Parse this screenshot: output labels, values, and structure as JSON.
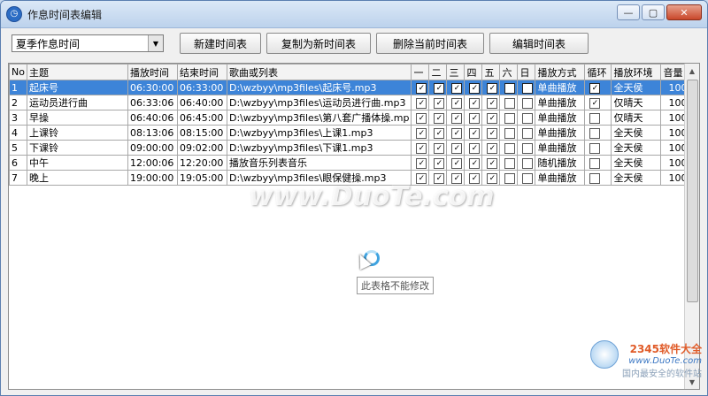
{
  "window": {
    "title": "作息时间表编辑",
    "app_icon": "clock-icon",
    "controls": {
      "minimize": "—",
      "maximize": "▢",
      "close": "✕"
    }
  },
  "toolbar": {
    "schedule_select": {
      "value": "夏季作息时间"
    },
    "buttons": {
      "new": "新建时间表",
      "copy": "复制为新时间表",
      "delete": "删除当前时间表",
      "edit": "编辑时间表"
    }
  },
  "table": {
    "headers": [
      "No",
      "主题",
      "播放时间",
      "结束时间",
      "歌曲或列表",
      "一",
      "二",
      "三",
      "四",
      "五",
      "六",
      "日",
      "播放方式",
      "循环",
      "播放环境",
      "音量"
    ],
    "selected_row": 0,
    "rows": [
      {
        "no": "1",
        "topic": "起床号",
        "start": "06:30:00",
        "end": "06:33:00",
        "song": "D:\\wzbyy\\mp3files\\起床号.mp3",
        "days": [
          true,
          true,
          true,
          true,
          true,
          false,
          false
        ],
        "mode": "单曲播放",
        "loop": true,
        "env": "全天侯",
        "volume": "100"
      },
      {
        "no": "2",
        "topic": "运动员进行曲",
        "start": "06:33:06",
        "end": "06:40:00",
        "song": "D:\\wzbyy\\mp3files\\运动员进行曲.mp3",
        "days": [
          true,
          true,
          true,
          true,
          true,
          false,
          false
        ],
        "mode": "单曲播放",
        "loop": true,
        "env": "仅晴天",
        "volume": "100"
      },
      {
        "no": "3",
        "topic": "早操",
        "start": "06:40:06",
        "end": "06:45:00",
        "song": "D:\\wzbyy\\mp3files\\第八套广播体操.mp",
        "days": [
          true,
          true,
          true,
          true,
          true,
          false,
          false
        ],
        "mode": "单曲播放",
        "loop": false,
        "env": "仅晴天",
        "volume": "100"
      },
      {
        "no": "4",
        "topic": "上课铃",
        "start": "08:13:06",
        "end": "08:15:00",
        "song": "D:\\wzbyy\\mp3files\\上课1.mp3",
        "days": [
          true,
          true,
          true,
          true,
          true,
          false,
          false
        ],
        "mode": "单曲播放",
        "loop": false,
        "env": "全天侯",
        "volume": "100"
      },
      {
        "no": "5",
        "topic": "下课铃",
        "start": "09:00:00",
        "end": "09:02:00",
        "song": "D:\\wzbyy\\mp3files\\下课1.mp3",
        "days": [
          true,
          true,
          true,
          true,
          true,
          false,
          false
        ],
        "mode": "单曲播放",
        "loop": false,
        "env": "全天侯",
        "volume": "100"
      },
      {
        "no": "6",
        "topic": "中午",
        "start": "12:00:06",
        "end": "12:20:00",
        "song": "播放音乐列表音乐",
        "days": [
          true,
          true,
          true,
          true,
          true,
          false,
          false
        ],
        "mode": "随机播放",
        "loop": false,
        "env": "全天侯",
        "volume": "100"
      },
      {
        "no": "7",
        "topic": "晚上",
        "start": "19:00:00",
        "end": "19:05:00",
        "song": "D:\\wzbyy\\mp3files\\眼保健操.mp3",
        "days": [
          true,
          true,
          true,
          true,
          true,
          false,
          false
        ],
        "mode": "单曲播放",
        "loop": false,
        "env": "全天侯",
        "volume": "100"
      }
    ]
  },
  "tooltip": "此表格不能修改",
  "watermark": "www.DuoTe.com",
  "corner_logo": {
    "line1": "2345软件大全",
    "line2": "www.DuoTe.com",
    "line3": "国内最安全的软件站"
  },
  "colors": {
    "selection": "#3d84d8",
    "titlebar": "#bcd2ec",
    "close": "#c9472a"
  }
}
